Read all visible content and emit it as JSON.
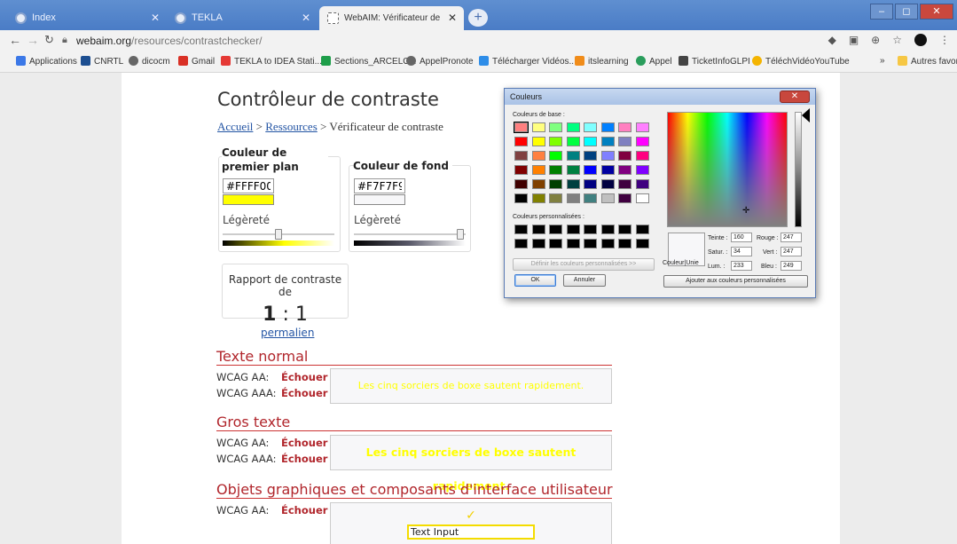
{
  "browser": {
    "tabs": [
      {
        "title": "Index"
      },
      {
        "title": "TEKLA"
      },
      {
        "title": "WebAIM: Vérificateur de contras"
      }
    ],
    "url_domain": "webaim.org",
    "url_path": "/resources/contrastchecker/",
    "bookmarks": [
      "Applications",
      "CNRTL",
      "dicocm",
      "Gmail",
      "TEKLA to IDEA Stati...",
      "Sections_ARCELOR",
      "AppelPronote",
      "Télécharger Vidéos...",
      "itslearning",
      "Appel",
      "TicketInfoGLPI",
      "TéléchVidéoYouTube",
      "»",
      "Autres favoris"
    ]
  },
  "page": {
    "title": "Contrôleur de contraste",
    "breadcrumb": {
      "home": "Accueil",
      "sep": ">",
      "resources": "Ressources",
      "current": "Vérificateur de contraste"
    },
    "foreground": {
      "legend": "Couleur de premier plan",
      "hex": "#FFFF00",
      "lightness_label": "Légèreté",
      "color": "#FFFF00",
      "lightness": 0.5
    },
    "background": {
      "legend": "Couleur de fond",
      "hex": "#F7F7F9",
      "lightness_label": "Légèreté",
      "color": "#F7F7F9",
      "lightness": 0.98
    },
    "ratio": {
      "label": "Rapport de contraste de",
      "left": "1",
      "sep": ":",
      "right": "1"
    },
    "permalink": "permalien",
    "normal_text": {
      "heading": "Texte normal",
      "rows": [
        {
          "label": "WCAG AA:",
          "result": "Échouer"
        },
        {
          "label": "WCAG AAA:",
          "result": "Échouer"
        }
      ],
      "sample": "Les cinq sorciers de boxe sautent rapidement."
    },
    "large_text": {
      "heading": "Gros texte",
      "rows": [
        {
          "label": "WCAG AA:",
          "result": "Échouer"
        },
        {
          "label": "WCAG AAA:",
          "result": "Échouer"
        }
      ],
      "sample": "Les cinq sorciers de boxe sautent rapidement."
    },
    "graphics": {
      "heading": "Objets graphiques et composants d'interface utilisateur",
      "rows": [
        {
          "label": "WCAG AA:",
          "result": "Échouer"
        }
      ],
      "checkmark": "✓",
      "input_text": "Text Input"
    }
  },
  "dialog": {
    "title": "Couleurs",
    "basic_label": "Couleurs de base :",
    "custom_label": "Couleurs personnalisées :",
    "define_btn": "Définir les couleurs personnalisées >>",
    "ok": "OK",
    "cancel": "Annuler",
    "add_btn": "Ajouter aux couleurs personnalisées",
    "solid_label": "Couleur|Unie",
    "fields": {
      "hue_label": "Teinte :",
      "hue": "160",
      "sat_label": "Satur. :",
      "sat": "34",
      "lum_label": "Lum. :",
      "lum": "233",
      "red_label": "Rouge :",
      "red": "247",
      "green_label": "Vert :",
      "green": "247",
      "blue_label": "Bleu :",
      "blue": "249"
    },
    "basic_colors": [
      "#FF8080",
      "#FFFF80",
      "#80FF80",
      "#00FF80",
      "#80FFFF",
      "#0080FF",
      "#FF80C0",
      "#FF80FF",
      "#FF0000",
      "#FFFF00",
      "#80FF00",
      "#00FF40",
      "#00FFFF",
      "#0080C0",
      "#8080C0",
      "#FF00FF",
      "#804040",
      "#FF8040",
      "#00FF00",
      "#008080",
      "#004080",
      "#8080FF",
      "#800040",
      "#FF0080",
      "#800000",
      "#FF8000",
      "#008000",
      "#008040",
      "#0000FF",
      "#0000A0",
      "#800080",
      "#8000FF",
      "#400000",
      "#804000",
      "#004000",
      "#004040",
      "#000080",
      "#000040",
      "#400040",
      "#400080",
      "#000000",
      "#808000",
      "#808040",
      "#808080",
      "#408080",
      "#C0C0C0",
      "#400040",
      "#FFFFFF"
    ],
    "custom_colors": [
      "#000000",
      "#000000",
      "#000000",
      "#000000",
      "#000000",
      "#000000",
      "#000000",
      "#000000",
      "#000000",
      "#000000",
      "#000000",
      "#000000",
      "#000000",
      "#000000",
      "#000000",
      "#000000"
    ]
  }
}
